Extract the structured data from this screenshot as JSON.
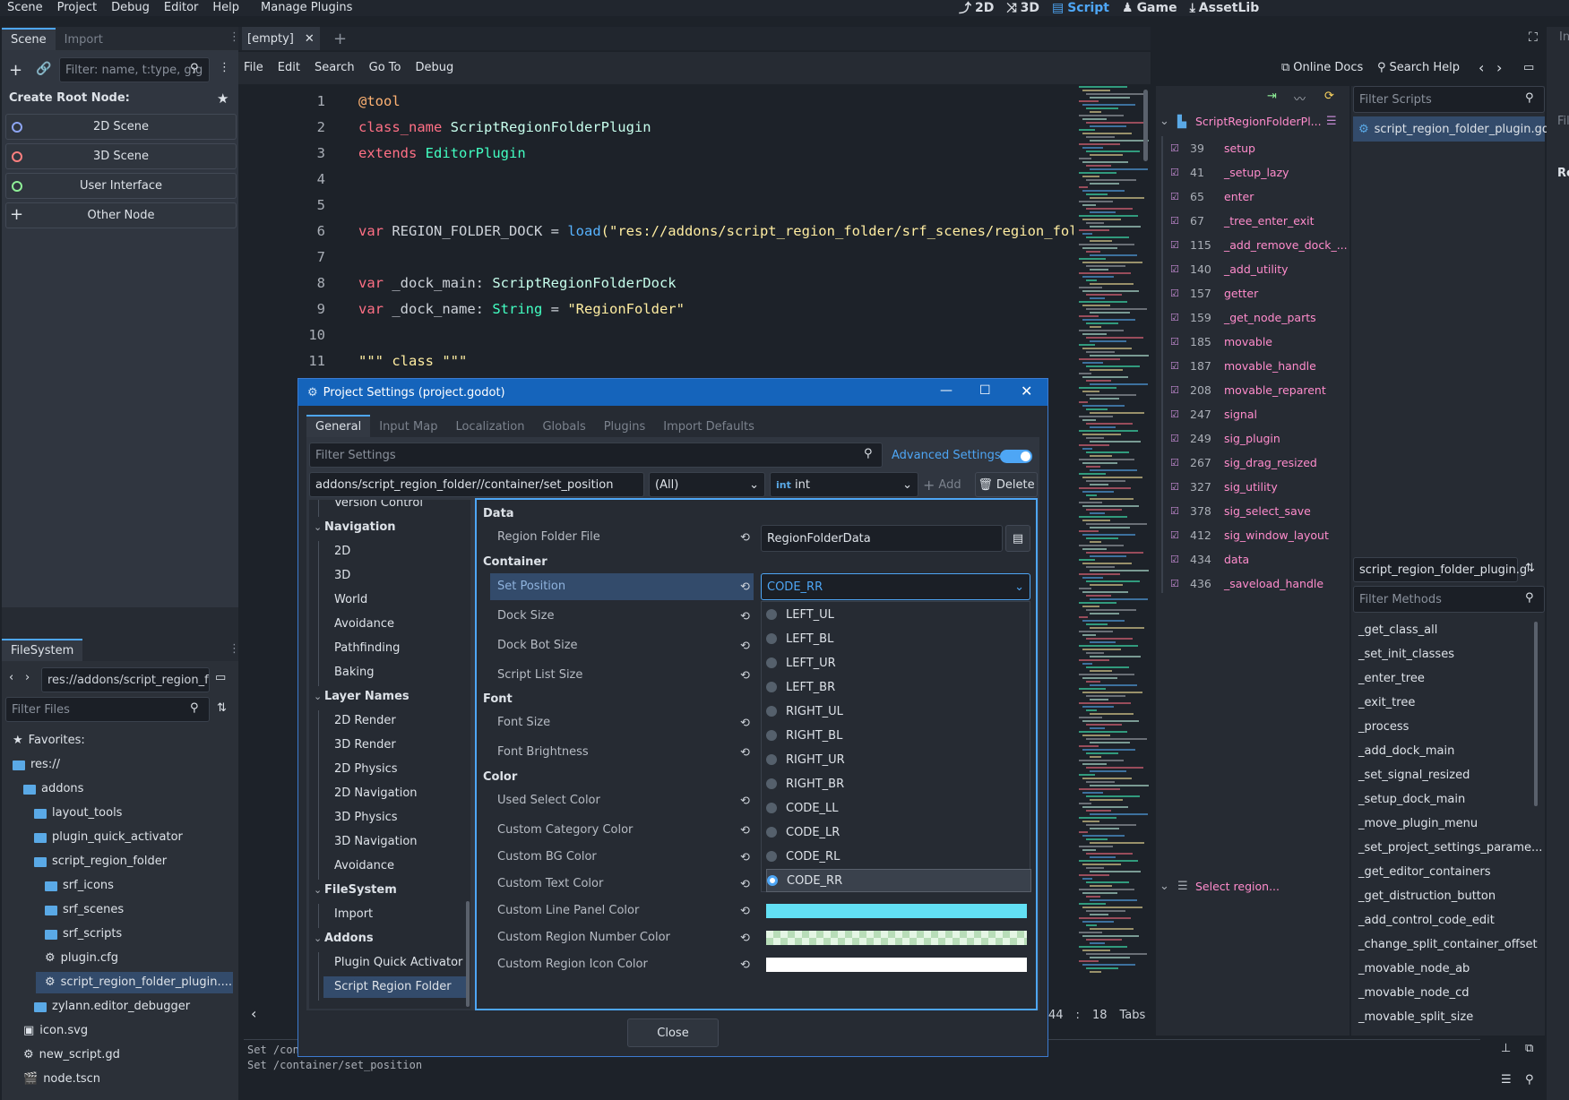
{
  "menu": {
    "items": [
      "Scene",
      "Project",
      "Debug",
      "Editor",
      "Help",
      "Manage Plugins"
    ]
  },
  "main_screens": [
    {
      "label": "2D",
      "icon": "2d-icon"
    },
    {
      "label": "3D",
      "icon": "3d-icon"
    },
    {
      "label": "Script",
      "icon": "script-icon",
      "active": true
    },
    {
      "label": "Game",
      "icon": "game-icon"
    },
    {
      "label": "AssetLib",
      "icon": "assetlib-icon"
    }
  ],
  "scene_dock": {
    "tabs": [
      "Scene",
      "Import"
    ],
    "filter_placeholder": "Filter: name, t:type, g:g",
    "create_root_label": "Create Root Node:",
    "buttons": [
      {
        "label": "2D Scene",
        "color": "#8da5f3"
      },
      {
        "label": "3D Scene",
        "color": "#fc7f7f"
      },
      {
        "label": "User Interface",
        "color": "#8eef97"
      },
      {
        "label": "Other Node",
        "color": "#dde2e8"
      }
    ]
  },
  "filesystem": {
    "tab": "FileSystem",
    "path": "res://addons/script_region_f",
    "filter_placeholder": "Filter Files",
    "tree": [
      {
        "label": "Favorites:",
        "indent": 0
      },
      {
        "label": "res://",
        "indent": 0
      },
      {
        "label": "addons",
        "indent": 1
      },
      {
        "label": "layout_tools",
        "indent": 2
      },
      {
        "label": "plugin_quick_activator",
        "indent": 2
      },
      {
        "label": "script_region_folder",
        "indent": 2
      },
      {
        "label": "srf_icons",
        "indent": 3
      },
      {
        "label": "srf_scenes",
        "indent": 3
      },
      {
        "label": "srf_scripts",
        "indent": 3
      },
      {
        "label": "plugin.cfg",
        "indent": 3
      },
      {
        "label": "script_region_folder_plugin....",
        "indent": 3,
        "selected": true
      },
      {
        "label": "zylann.editor_debugger",
        "indent": 2
      },
      {
        "label": "icon.svg",
        "indent": 1
      },
      {
        "label": "new_script.gd",
        "indent": 1
      },
      {
        "label": "node.tscn",
        "indent": 1
      }
    ]
  },
  "script_editor": {
    "tab": "[empty]",
    "menu": [
      "File",
      "Edit",
      "Search",
      "Go To",
      "Debug"
    ],
    "online_docs": "Online Docs",
    "search_help": "Search Help",
    "lines": [
      "1",
      "2",
      "3",
      "4",
      "5",
      "6",
      "7",
      "8",
      "9",
      "10",
      "11"
    ],
    "code": {
      "l1": "@tool",
      "l2a": "class_name",
      "l2b": "ScriptRegionFolderPlugin",
      "l3a": "extends",
      "l3b": "EditorPlugin",
      "l6a": "var",
      "l6b": " REGION_FOLDER_DOCK ",
      "l6c": "=",
      "l6d": "load",
      "l6e": "(\"res://addons/script_region_folder/srf_scenes/region_folder",
      "l8a": "var",
      "l8b": " _dock_main: ",
      "l8c": "ScriptRegionFolderDock",
      "l9a": "var",
      "l9b": " _dock_name: ",
      "l9c": "String",
      "l9d": " = ",
      "l9e": "\"RegionFolder\"",
      "l11": "\"\"\" class \"\"\""
    },
    "status": {
      "pos": "44",
      "col": "18",
      "indent": "Tabs"
    },
    "output": [
      "Set /con",
      "Set /container/set_position"
    ]
  },
  "outline": {
    "title": "ScriptRegionFolderPl...",
    "items": [
      [
        "39",
        "setup"
      ],
      [
        "41",
        "_setup_lazy"
      ],
      [
        "65",
        "enter"
      ],
      [
        "67",
        "_tree_enter_exit"
      ],
      [
        "115",
        "_add_remove_dock_..."
      ],
      [
        "140",
        "_add_utility"
      ],
      [
        "157",
        "getter"
      ],
      [
        "159",
        "_get_node_parts"
      ],
      [
        "185",
        "movable"
      ],
      [
        "187",
        "movable_handle"
      ],
      [
        "208",
        "movable_reparent"
      ],
      [
        "247",
        "signal"
      ],
      [
        "249",
        "sig_plugin"
      ],
      [
        "267",
        "sig_drag_resized"
      ],
      [
        "327",
        "sig_utility"
      ],
      [
        "378",
        "sig_select_save"
      ],
      [
        "412",
        "sig_window_layout"
      ],
      [
        "434",
        "data"
      ],
      [
        "436",
        "_saveload_handle"
      ]
    ],
    "select_region": "Select region..."
  },
  "scripts_panel": {
    "filter_placeholder": "Filter Scripts",
    "current": "script_region_folder_plugin.gd",
    "name_field": "script_region_folder_plugin.g",
    "methods_placeholder": "Filter Methods",
    "methods": [
      "_get_class_all",
      "_set_init_classes",
      "_enter_tree",
      "_exit_tree",
      "_process",
      "_add_dock_main",
      "_set_signal_resized",
      "_setup_dock_main",
      "_move_plugin_menu",
      "_set_project_settings_parame...",
      "_get_editor_containers",
      "_get_distruction_button",
      "_add_control_code_edit",
      "_change_split_container_offset",
      "_movable_node_ab",
      "_movable_node_cd",
      "_movable_split_size"
    ]
  },
  "project_settings": {
    "title": "Project Settings (project.godot)",
    "tabs": [
      "General",
      "Input Map",
      "Localization",
      "Globals",
      "Plugins",
      "Import Defaults"
    ],
    "filter_placeholder": "Filter Settings",
    "advanced": "Advanced Settings",
    "property_path": "addons/script_region_folder//container/set_position",
    "type_all": "(All)",
    "type_int_badge": "int",
    "type_int": "int",
    "add": "Add",
    "delete": "Delete",
    "close": "Close",
    "tree": [
      {
        "label": "Version Control",
        "lvl": 1
      },
      {
        "label": "Navigation",
        "lvl": 0
      },
      {
        "label": "2D",
        "lvl": 1
      },
      {
        "label": "3D",
        "lvl": 1
      },
      {
        "label": "World",
        "lvl": 1
      },
      {
        "label": "Avoidance",
        "lvl": 1
      },
      {
        "label": "Pathfinding",
        "lvl": 1
      },
      {
        "label": "Baking",
        "lvl": 1
      },
      {
        "label": "Layer Names",
        "lvl": 0
      },
      {
        "label": "2D Render",
        "lvl": 1
      },
      {
        "label": "3D Render",
        "lvl": 1
      },
      {
        "label": "2D Physics",
        "lvl": 1
      },
      {
        "label": "2D Navigation",
        "lvl": 1
      },
      {
        "label": "3D Physics",
        "lvl": 1
      },
      {
        "label": "3D Navigation",
        "lvl": 1
      },
      {
        "label": "Avoidance",
        "lvl": 1
      },
      {
        "label": "FileSystem",
        "lvl": 0
      },
      {
        "label": "Import",
        "lvl": 1
      },
      {
        "label": "Addons",
        "lvl": 0
      },
      {
        "label": "Plugin Quick Activator",
        "lvl": 1
      },
      {
        "label": "Script Region Folder",
        "lvl": 1,
        "selected": true
      }
    ],
    "sections": {
      "data": "Data",
      "container": "Container",
      "font": "Font",
      "color": "Color"
    },
    "props": {
      "region_folder_file": "Region Folder File",
      "region_folder_value": "RegionFolderData",
      "set_position": "Set Position",
      "set_position_value": "CODE_RR",
      "dock_size": "Dock Size",
      "dock_bot_size": "Dock Bot Size",
      "script_list_size": "Script List Size",
      "font_size": "Font Size",
      "font_brightness": "Font Brightness",
      "used_select_color": "Used Select Color",
      "custom_category_color": "Custom Category Color",
      "custom_bg_color": "Custom BG Color",
      "custom_text_color": "Custom Text Color",
      "custom_line_panel_color": "Custom Line Panel Color",
      "custom_region_number_color": "Custom Region Number Color",
      "custom_region_icon_color": "Custom Region Icon Color"
    },
    "colors": {
      "line_panel": "#62e0f5",
      "region_icon": "#ffffff"
    },
    "options": [
      "LEFT_UL",
      "LEFT_BL",
      "LEFT_UR",
      "LEFT_BR",
      "RIGHT_UL",
      "RIGHT_BL",
      "RIGHT_UR",
      "RIGHT_BR",
      "CODE_LL",
      "CODE_LR",
      "CODE_RL",
      "CODE_RR"
    ],
    "selected_option": "CODE_RR"
  },
  "right_edge": {
    "tab": "In",
    "label1": "Fil",
    "label2": "Re"
  }
}
